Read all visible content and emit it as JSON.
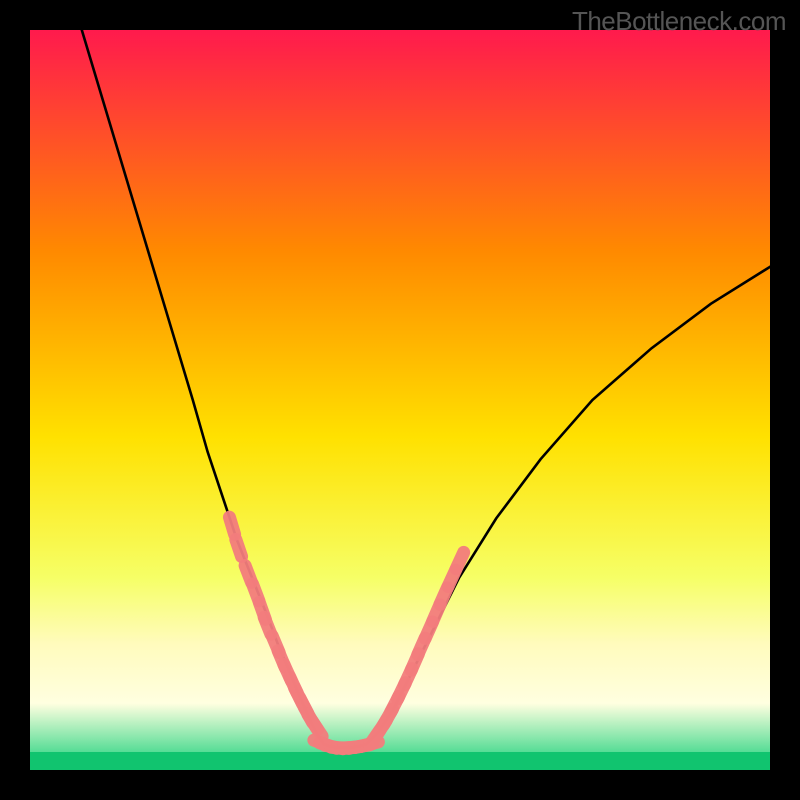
{
  "watermark": "TheBottleneck.com",
  "chart_data": {
    "type": "line",
    "title": "",
    "xlabel": "",
    "ylabel": "",
    "xlim": [
      0,
      100
    ],
    "ylim": [
      0,
      100
    ],
    "background_gradient": {
      "top": "#ff1a4d",
      "mid_upper": "#ff8a00",
      "mid": "#ffe100",
      "mid_lower": "#f6ff66",
      "band_pale": "#fffbbd",
      "bottom": "#17d07a"
    },
    "series": [
      {
        "name": "left-arm",
        "type": "line",
        "x": [
          7,
          10,
          13,
          16,
          19,
          22,
          24,
          26,
          28,
          30,
          32,
          33.5,
          35,
          36.2,
          37.3,
          38.2,
          39,
          39.7
        ],
        "y": [
          100,
          90,
          80,
          70,
          60,
          50,
          43,
          37,
          31,
          26,
          21,
          17,
          13.5,
          10.5,
          8,
          6,
          4.5,
          3.5
        ],
        "color": "#000000"
      },
      {
        "name": "valley-floor",
        "type": "line",
        "x": [
          39.7,
          40.5,
          41.5,
          42.5,
          43.5,
          44.5,
          45.5
        ],
        "y": [
          3.5,
          3.2,
          3.05,
          3.0,
          3.05,
          3.2,
          3.5
        ],
        "color": "#000000"
      },
      {
        "name": "right-arm",
        "type": "line",
        "x": [
          45.5,
          47,
          49,
          51,
          54,
          58,
          63,
          69,
          76,
          84,
          92,
          100
        ],
        "y": [
          3.5,
          5,
          8,
          12,
          18,
          26,
          34,
          42,
          50,
          57,
          63,
          68
        ],
        "color": "#000000"
      },
      {
        "name": "dots-left",
        "type": "scatter",
        "x": [
          27.3,
          28.2,
          29.5,
          30.5,
          31.4,
          32.1,
          33.2,
          34.0,
          34.8,
          35.6,
          36.3,
          37.0,
          37.6,
          38.2,
          38.8
        ],
        "y": [
          33.0,
          30.0,
          26.5,
          24.0,
          21.5,
          19.5,
          17.0,
          15.0,
          13.2,
          11.5,
          10.0,
          8.7,
          7.5,
          6.5,
          5.6
        ],
        "color": "#f37d7d"
      },
      {
        "name": "dots-bottom",
        "type": "scatter",
        "x": [
          39.5,
          40.3,
          41.1,
          41.9,
          42.7,
          43.5,
          44.3,
          45.1,
          45.9
        ],
        "y": [
          3.6,
          3.3,
          3.1,
          3.0,
          3.0,
          3.05,
          3.15,
          3.3,
          3.5
        ],
        "color": "#f37d7d"
      },
      {
        "name": "dots-right",
        "type": "scatter",
        "x": [
          46.6,
          47.5,
          48.4,
          49.3,
          50.2,
          51.1,
          52.0,
          52.9,
          53.9,
          54.9,
          55.9,
          57.0,
          58.1
        ],
        "y": [
          4.4,
          5.7,
          7.2,
          8.9,
          10.7,
          12.6,
          14.6,
          16.7,
          18.9,
          21.2,
          23.5,
          25.9,
          28.3
        ],
        "color": "#f37d7d"
      }
    ]
  }
}
